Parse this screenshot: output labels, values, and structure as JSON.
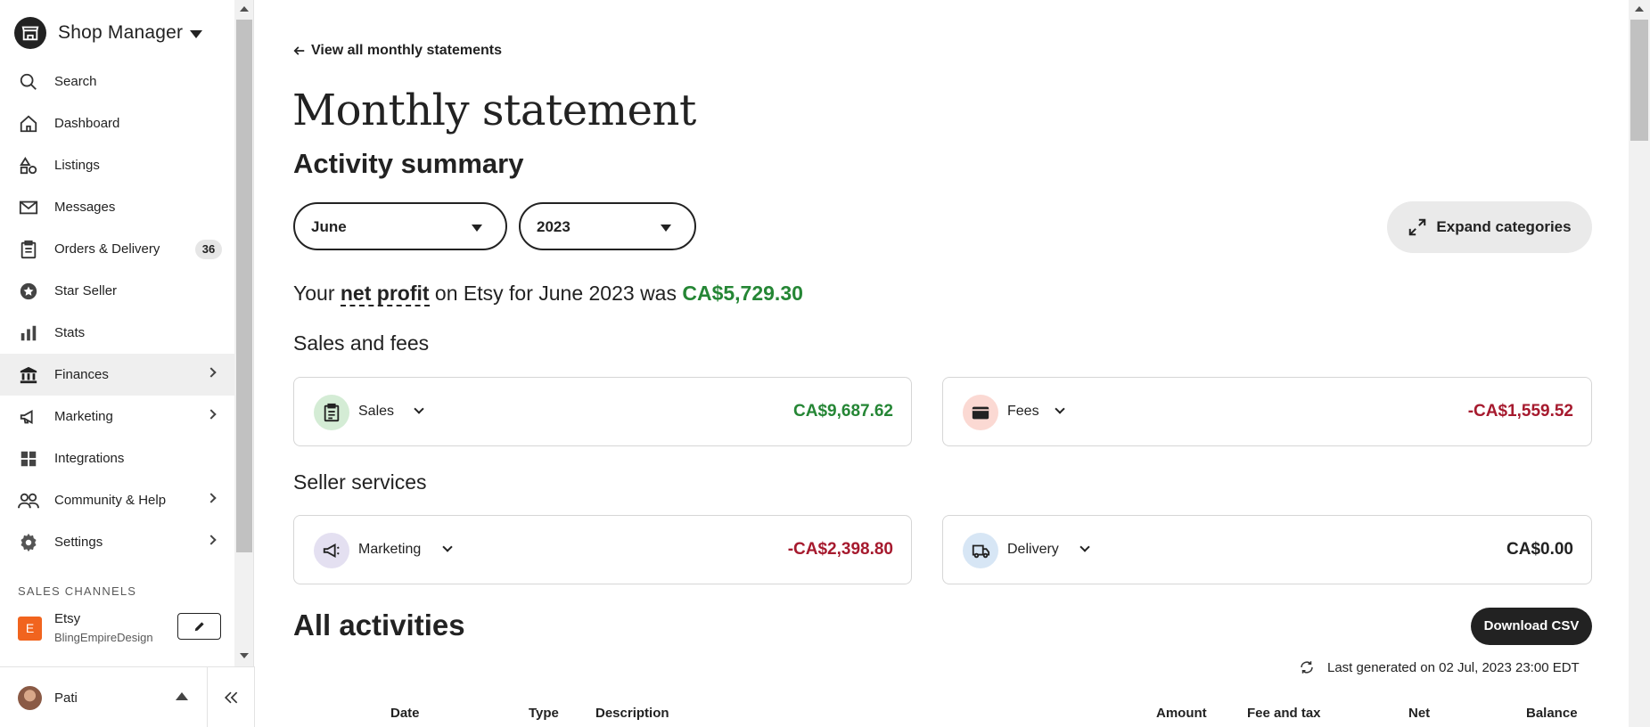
{
  "sidebar": {
    "title": "Shop Manager",
    "items": [
      {
        "label": "Search",
        "icon": "search-icon"
      },
      {
        "label": "Dashboard",
        "icon": "home-icon"
      },
      {
        "label": "Listings",
        "icon": "shapes-icon"
      },
      {
        "label": "Messages",
        "icon": "envelope-icon"
      },
      {
        "label": "Orders & Delivery",
        "icon": "clipboard-icon",
        "badge": "36"
      },
      {
        "label": "Star Seller",
        "icon": "star-badge-icon"
      },
      {
        "label": "Stats",
        "icon": "bar-chart-icon"
      },
      {
        "label": "Finances",
        "icon": "bank-icon",
        "active": true
      },
      {
        "label": "Marketing",
        "icon": "megaphone-icon"
      },
      {
        "label": "Integrations",
        "icon": "grid-icon"
      },
      {
        "label": "Community & Help",
        "icon": "people-icon"
      },
      {
        "label": "Settings",
        "icon": "gear-icon"
      }
    ],
    "channels_heading": "SALES CHANNELS",
    "channel": {
      "logo_letter": "E",
      "name": "Etsy",
      "shop": "BlingEmpireDesign"
    },
    "user": {
      "name": "Pati"
    }
  },
  "main": {
    "back_link": "View all monthly statements",
    "title": "Monthly statement",
    "activity_heading": "Activity summary",
    "month_select": "June",
    "year_select": "2023",
    "expand_button": "Expand categories",
    "profit": {
      "prefix": "Your ",
      "term": "net profit",
      "middle": " on Etsy for June 2023 was ",
      "amount": "CA$5,729.30"
    },
    "sales_fees_heading": "Sales and fees",
    "seller_services_heading": "Seller services",
    "cards": {
      "sales": {
        "label": "Sales",
        "amount": "CA$9,687.62"
      },
      "fees": {
        "label": "Fees",
        "amount": "-CA$1,559.52"
      },
      "marketing": {
        "label": "Marketing",
        "amount": "-CA$2,398.80"
      },
      "delivery": {
        "label": "Delivery",
        "amount": "CA$0.00"
      }
    },
    "all_activities_heading": "All activities",
    "download_csv": "Download CSV",
    "last_generated": "Last generated on 02 Jul, 2023 23:00 EDT",
    "table_headers": {
      "date": "Date",
      "type": "Type",
      "description": "Description",
      "amount": "Amount",
      "fee_tax": "Fee and tax",
      "net": "Net",
      "balance": "Balance"
    }
  },
  "colors": {
    "positive": "#258635",
    "negative": "#a61a2e",
    "sales_icon_bg": "#d4ecd5",
    "fees_icon_bg": "#fbd9d3",
    "marketing_icon_bg": "#e4e0f1",
    "delivery_icon_bg": "#d7e6f5"
  }
}
